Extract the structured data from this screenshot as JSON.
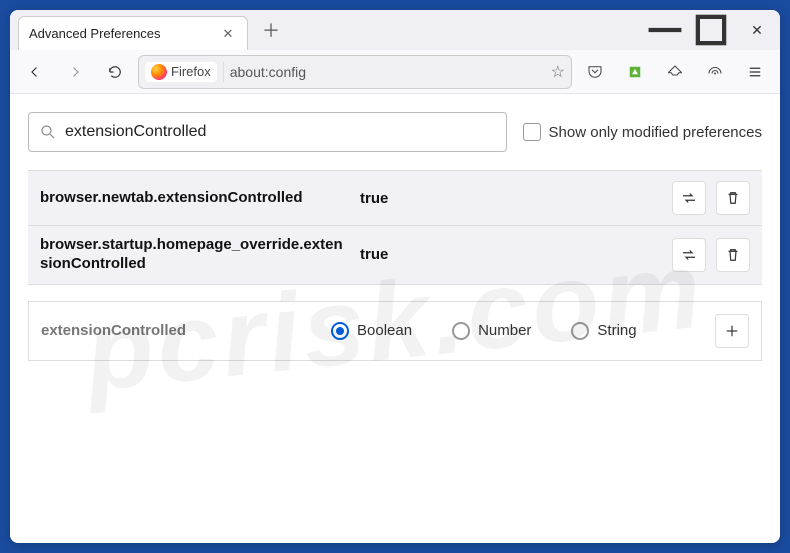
{
  "window": {
    "tab_title": "Advanced Preferences"
  },
  "urlbar": {
    "identity_label": "Firefox",
    "url": "about:config"
  },
  "filter": {
    "search_value": "extensionControlled",
    "show_modified_label": "Show only modified preferences",
    "show_modified_checked": false
  },
  "prefs": [
    {
      "name": "browser.newtab.extensionControlled",
      "value": "true"
    },
    {
      "name": "browser.startup.homepage_override.extensionControlled",
      "value": "true"
    }
  ],
  "new_pref": {
    "name": "extensionControlled",
    "types": [
      "Boolean",
      "Number",
      "String"
    ],
    "selected": "Boolean"
  },
  "watermark": "pcrisk.com"
}
